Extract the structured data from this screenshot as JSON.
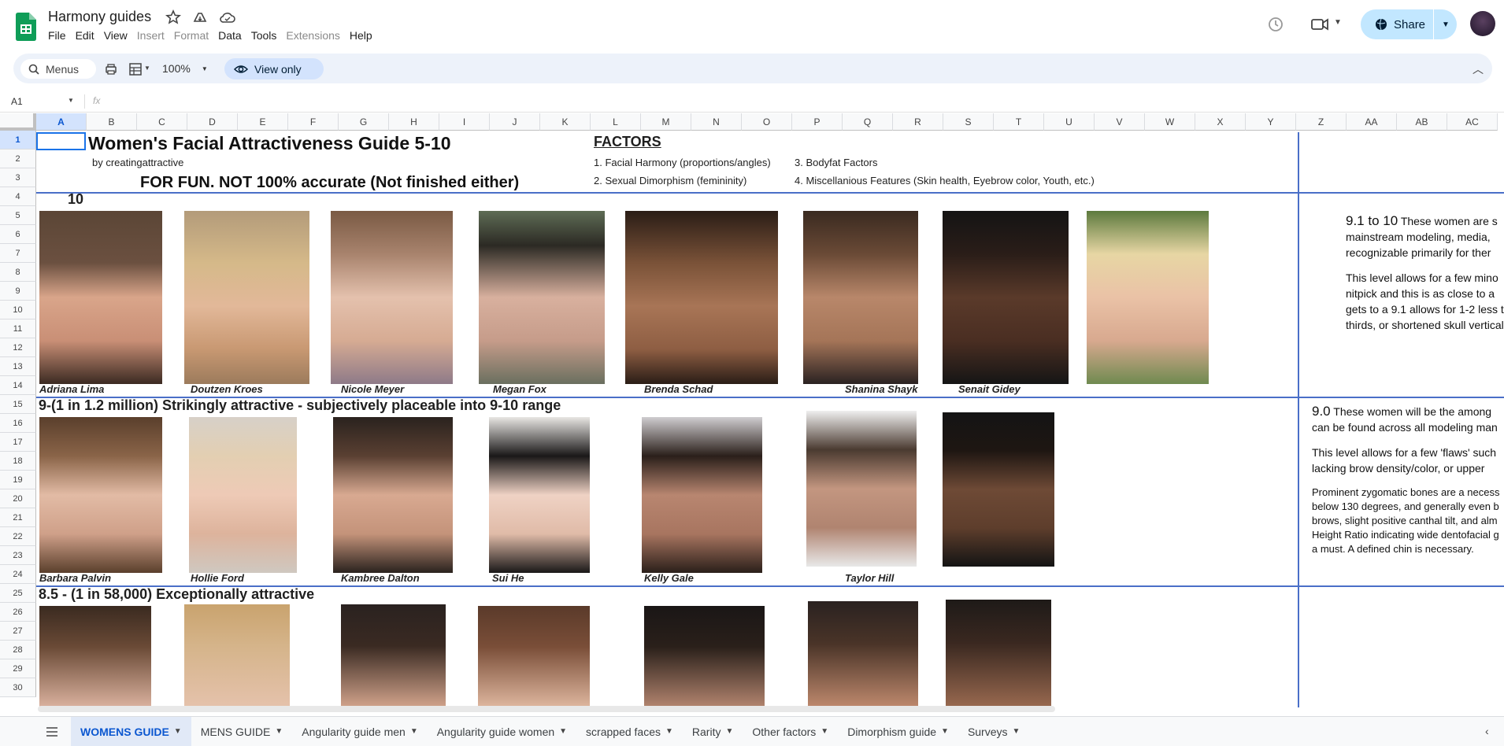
{
  "doc": {
    "title": "Harmony guides",
    "menus": [
      "File",
      "Edit",
      "View",
      "Insert",
      "Format",
      "Data",
      "Tools",
      "Extensions",
      "Help"
    ],
    "disabled_menus": [
      "Insert",
      "Format",
      "Extensions"
    ]
  },
  "toolbar": {
    "search_placeholder": "Menus",
    "zoom": "100%",
    "view_only": "View only",
    "share": "Share"
  },
  "formula": {
    "cell_ref": "A1",
    "fx": "fx"
  },
  "columns": [
    "A",
    "B",
    "C",
    "D",
    "E",
    "F",
    "G",
    "H",
    "I",
    "J",
    "K",
    "L",
    "M",
    "N",
    "O",
    "P",
    "Q",
    "R",
    "S",
    "T",
    "U",
    "V",
    "W",
    "X",
    "Y",
    "Z",
    "AA",
    "AB",
    "AC"
  ],
  "rows": [
    "1",
    "2",
    "3",
    "4",
    "5",
    "6",
    "7",
    "8",
    "9",
    "10",
    "11",
    "12",
    "13",
    "14",
    "15",
    "16",
    "17",
    "18",
    "19",
    "20",
    "21",
    "22",
    "23",
    "24",
    "25",
    "26",
    "27",
    "28",
    "29",
    "30"
  ],
  "sheet": {
    "title": "Women's Facial Attractiveness Guide 5-10",
    "byline": "by creatingattractive",
    "disclaimer": "FOR FUN. NOT 100% accurate (Not finished either)",
    "factors_title": "FACTORS",
    "factors": [
      "1. Facial Harmony (proportions/angles)",
      "2. Sexual Dimorphism (femininity)",
      "3. Bodyfat Factors",
      "4. Miscellanious Features (Skin health, Eyebrow color, Youth, etc.)"
    ],
    "tier10_label": "10",
    "tier10_names": [
      "Adriana Lima",
      "Doutzen Kroes",
      "Nicole Meyer",
      "Megan Fox",
      "Brenda Schad",
      "Shanina Shayk",
      "Senait Gidey"
    ],
    "tier9_label": "9-(1 in 1.2 million) Strikingly attractive - subjectively placeable into 9-10 range",
    "tier9_names": [
      "Barbara Palvin",
      "Hollie Ford",
      "Kambree Dalton",
      "Sui He",
      "Kelly Gale",
      "Taylor Hill"
    ],
    "tier85_label": "8.5 - (1 in 58,000) Exceptionally attractive",
    "side10_lead": "9.1 to 10",
    "side10_lines": [
      "These women are s",
      "mainstream modeling, media,",
      "recognizable primarily for ther"
    ],
    "side10_para2": [
      "This level allows for a few mino",
      "nitpick and this is as close to a",
      "gets to a 9.1 allows  for 1-2 less t",
      "thirds, or shortened skull verticali"
    ],
    "side9_lead": "9.0",
    "side9_lines": [
      "These women will be the among",
      "can be found across all modeling man"
    ],
    "side9_para2": [
      "This level allows for a  few 'flaws' such",
      "lacking brow density/color,  or upper"
    ],
    "side9_para3": [
      "Prominent zygomatic bones are a necess",
      "below 130 degrees, and generally even b",
      "brows, slight positive canthal tilt, and alm",
      "Height Ratio indicating wide dentofacial g",
      "a must. A defined chin is necessary."
    ]
  },
  "tabs": [
    "WOMENS GUIDE",
    "MENS GUIDE",
    "Angularity guide men",
    "Angularity guide women",
    "scrapped faces",
    "Rarity",
    "Other factors",
    "Dimorphism guide",
    "Surveys"
  ],
  "colors": {
    "accent": "#0b57d0",
    "share_bg": "#c2e7ff",
    "separator": "#4a6fc8",
    "sheets_green": "#0f9d58"
  }
}
